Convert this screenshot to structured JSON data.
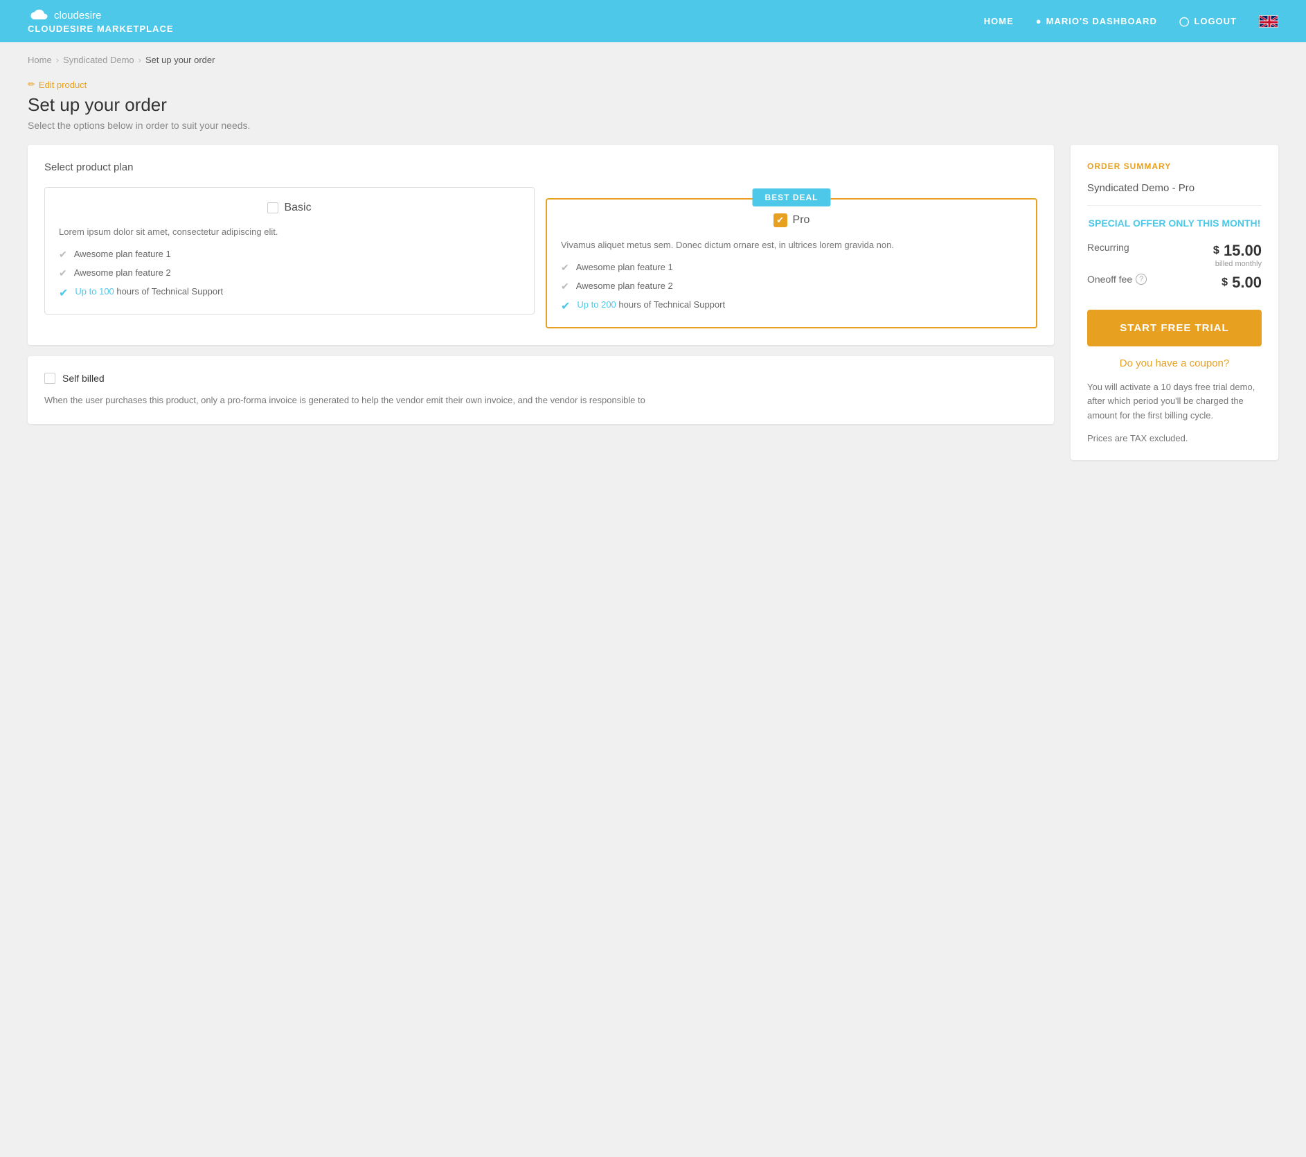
{
  "header": {
    "logo_name": "cloudesire",
    "marketplace_label": "CLOUDESIRE MARKETPLACE",
    "nav": {
      "home": "HOME",
      "dashboard": "MARIO'S DASHBOARD",
      "logout": "LOGOUT"
    }
  },
  "breadcrumb": {
    "home": "Home",
    "product": "Syndicated Demo",
    "current": "Set up your order"
  },
  "page": {
    "edit_label": "Edit product",
    "title": "Set up your order",
    "subtitle": "Select the options below in order to suit your needs."
  },
  "plan_section": {
    "title": "Select product plan",
    "plans": [
      {
        "id": "basic",
        "name": "Basic",
        "selected": false,
        "best_deal": false,
        "description": "Lorem ipsum dolor sit amet, consectetur adipiscing elit.",
        "features": [
          {
            "text": "Awesome plan feature 1",
            "highlight": false
          },
          {
            "text": "Awesome plan feature 2",
            "highlight": false
          },
          {
            "text": "Up to 100 hours of Technical Support",
            "highlight": true,
            "highlight_prefix": "Up to 100",
            "normal_suffix": " hours of Technical Support"
          }
        ]
      },
      {
        "id": "pro",
        "name": "Pro",
        "selected": true,
        "best_deal": true,
        "best_deal_label": "BEST DEAL",
        "description": "Vivamus aliquet metus sem. Donec dictum ornare est, in ultrices lorem gravida non.",
        "features": [
          {
            "text": "Awesome plan feature 1",
            "highlight": false
          },
          {
            "text": "Awesome plan feature 2",
            "highlight": false
          },
          {
            "text": "Up to 200 hours of Technical Support",
            "highlight": true,
            "highlight_prefix": "Up to 200",
            "normal_suffix": " hours of Technical Support"
          }
        ]
      }
    ]
  },
  "self_billed": {
    "label": "Self billed",
    "description": "When the user purchases this product, only a pro-forma invoice is generated to help the vendor emit their own invoice, and the vendor is responsible to"
  },
  "order_summary": {
    "title": "ORDER SUMMARY",
    "product_name": "Syndicated Demo - Pro",
    "special_offer": "SPECIAL OFFER ONLY THIS MONTH!",
    "recurring_label": "Recurring",
    "recurring_amount": "15.00",
    "recurring_sub": "billed monthly",
    "oneoff_label": "Oneoff fee",
    "oneoff_amount": "5.00",
    "cta_label": "START FREE TRIAL",
    "coupon_label": "Do you have a coupon?",
    "trial_info": "You will activate a 10 days free trial demo, after which period you'll be charged the amount for the first billing cycle.",
    "tax_info": "Prices are TAX excluded."
  }
}
